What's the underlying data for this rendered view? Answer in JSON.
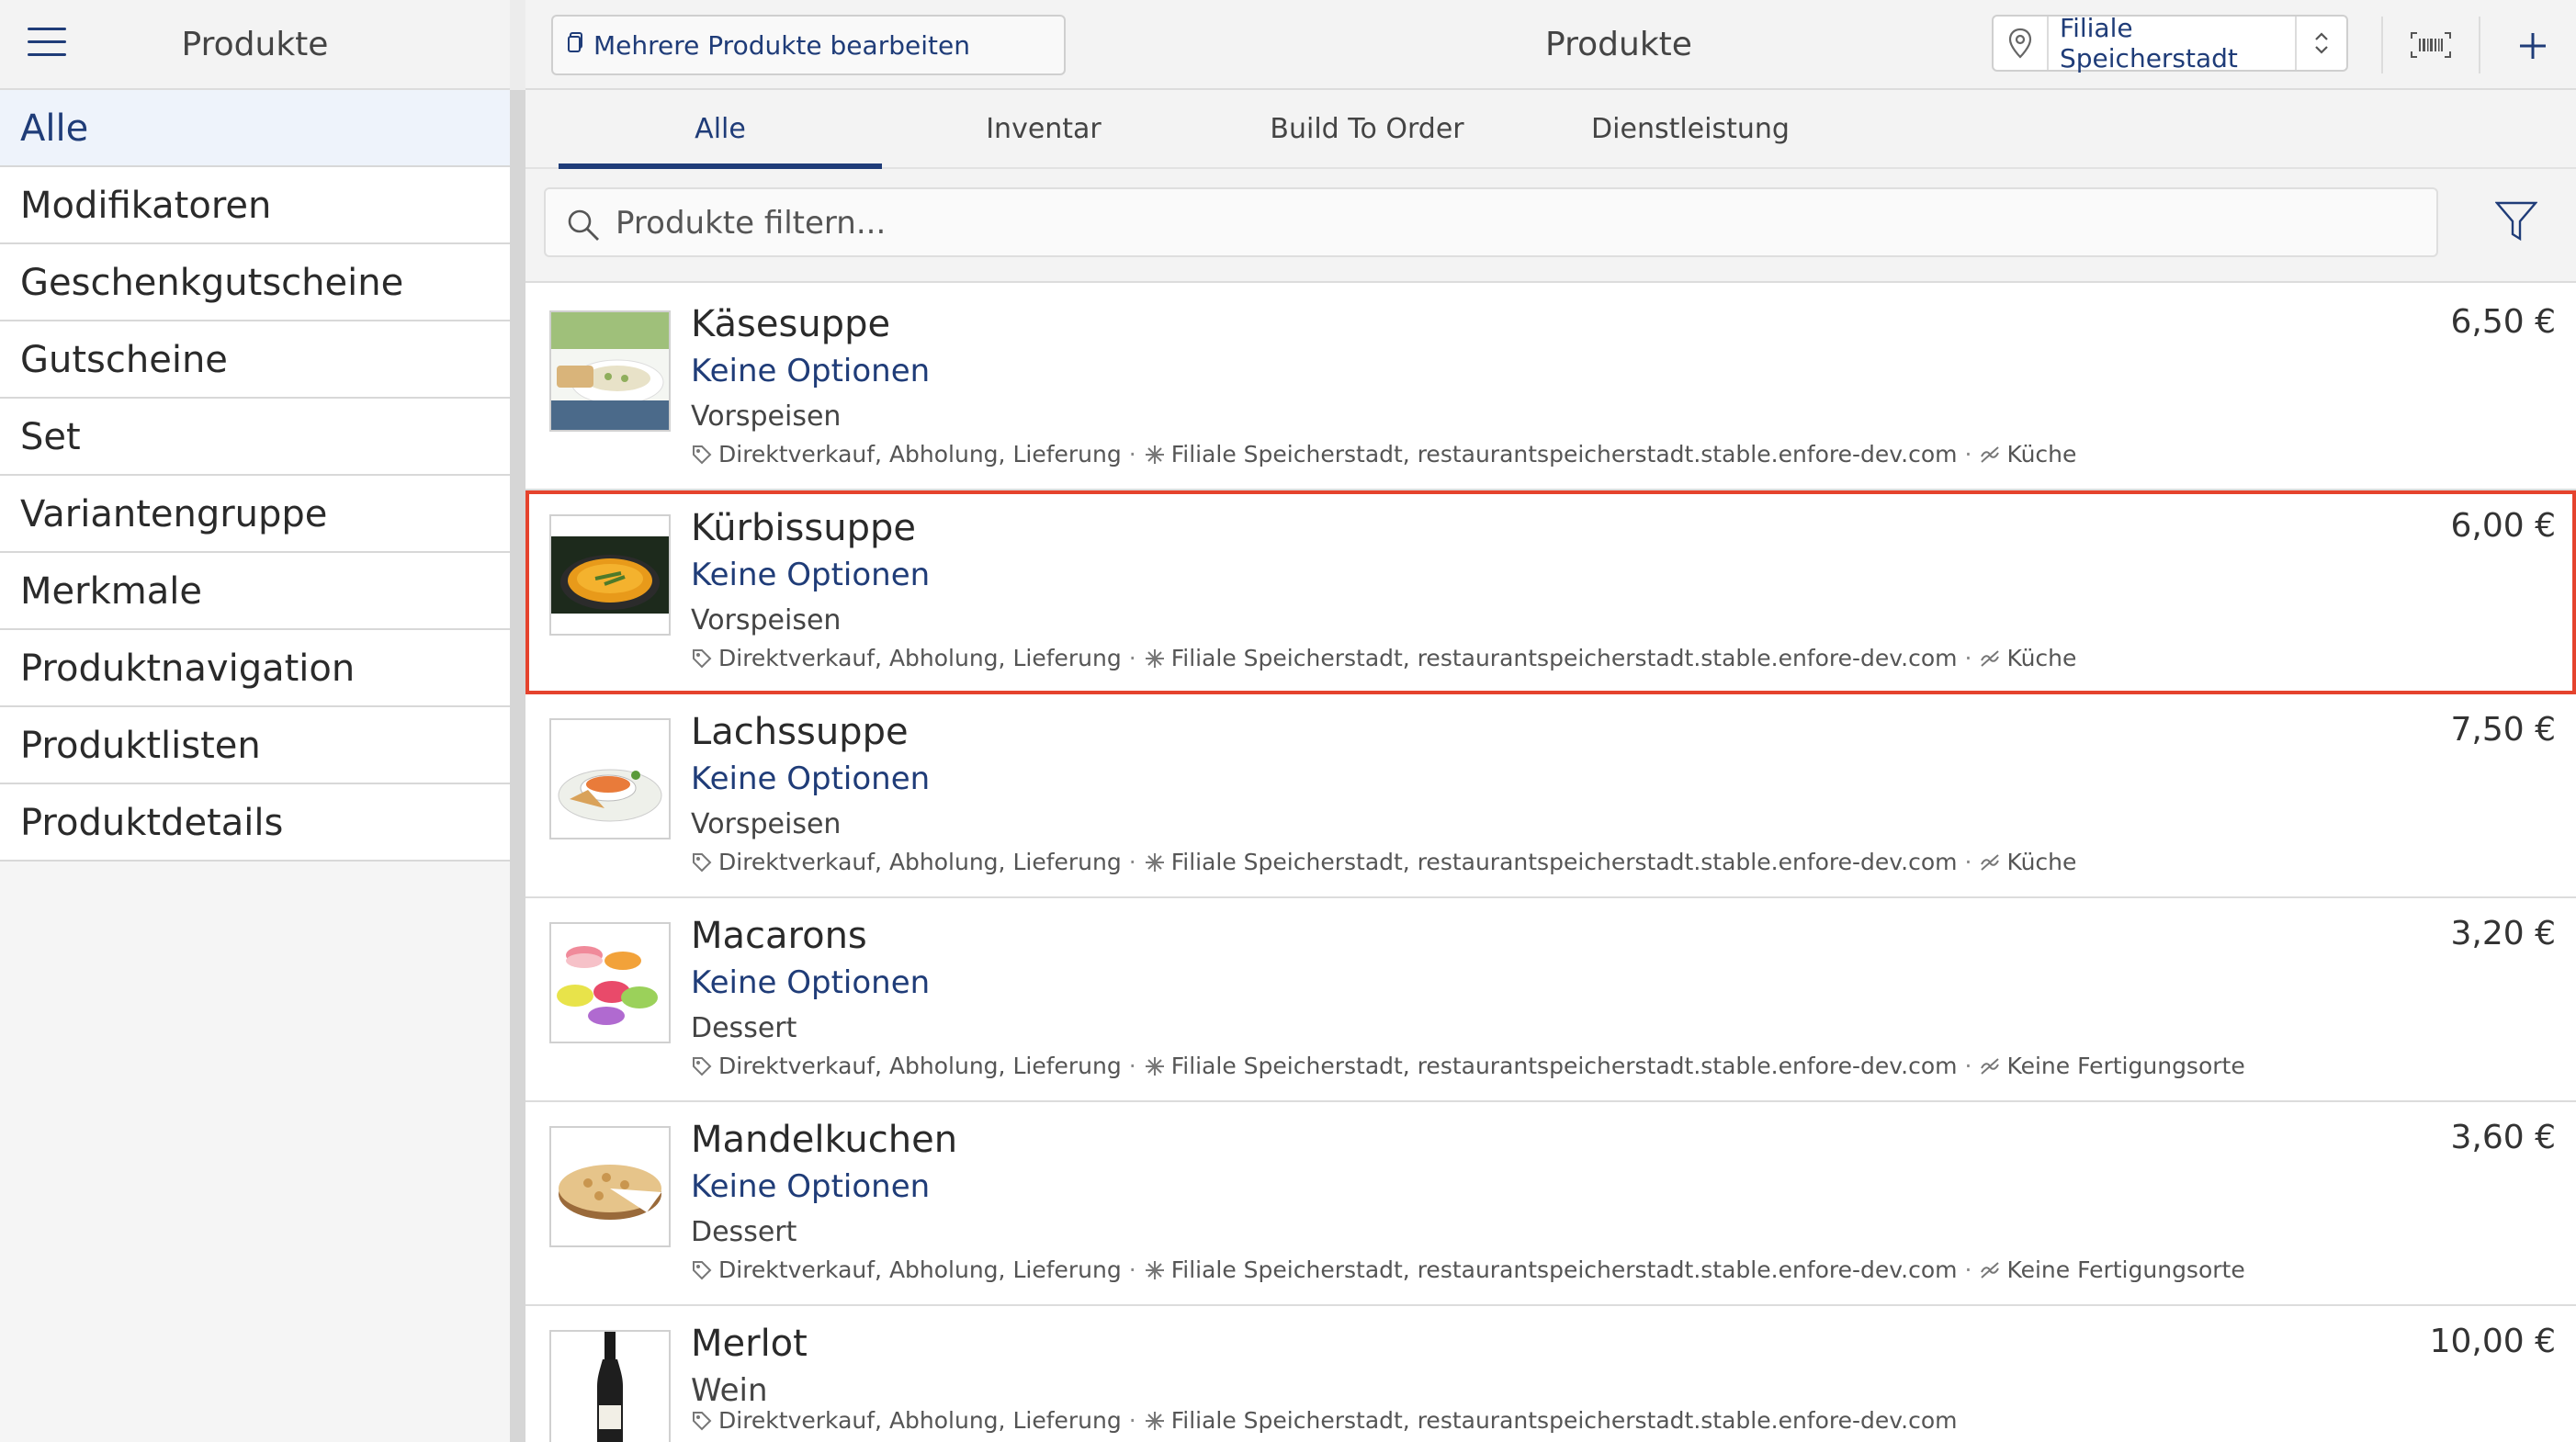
{
  "sidebar": {
    "title": "Produkte",
    "items": [
      {
        "label": "Alle"
      },
      {
        "label": "Modifikatoren"
      },
      {
        "label": "Geschenkgutscheine"
      },
      {
        "label": "Gutscheine"
      },
      {
        "label": "Set"
      },
      {
        "label": "Variantengruppe"
      },
      {
        "label": "Merkmale"
      },
      {
        "label": "Produktnavigation"
      },
      {
        "label": "Produktlisten"
      },
      {
        "label": "Produktdetails"
      }
    ]
  },
  "header": {
    "multi_edit_label": "Mehrere Produkte bearbeiten",
    "title": "Produkte",
    "branch": "Filiale Speicherstadt"
  },
  "tabs": [
    {
      "label": "Alle"
    },
    {
      "label": "Inventar"
    },
    {
      "label": "Build To Order"
    },
    {
      "label": "Dienstleistung"
    }
  ],
  "search": {
    "placeholder": "Produkte filtern..."
  },
  "products": [
    {
      "name": "Käsesuppe",
      "options": "Keine Optionen",
      "category": "Vorspeisen",
      "channels": "Direktverkauf, Abholung, Lieferung",
      "locations": "Filiale Speicherstadt, restaurantspeicherstadt.stable.enfore-dev.com",
      "production": "Küche",
      "price": "6,50 €"
    },
    {
      "name": "Kürbissuppe",
      "options": "Keine Optionen",
      "category": "Vorspeisen",
      "channels": "Direktverkauf, Abholung, Lieferung",
      "locations": "Filiale Speicherstadt, restaurantspeicherstadt.stable.enfore-dev.com",
      "production": "Küche",
      "price": "6,00 €"
    },
    {
      "name": "Lachssuppe",
      "options": "Keine Optionen",
      "category": "Vorspeisen",
      "channels": "Direktverkauf, Abholung, Lieferung",
      "locations": "Filiale Speicherstadt, restaurantspeicherstadt.stable.enfore-dev.com",
      "production": "Küche",
      "price": "7,50 €"
    },
    {
      "name": "Macarons",
      "options": "Keine Optionen",
      "category": "Dessert",
      "channels": "Direktverkauf, Abholung, Lieferung",
      "locations": "Filiale Speicherstadt, restaurantspeicherstadt.stable.enfore-dev.com",
      "production": "Keine Fertigungsorte",
      "price": "3,20 €"
    },
    {
      "name": "Mandelkuchen",
      "options": "Keine Optionen",
      "category": "Dessert",
      "channels": "Direktverkauf, Abholung, Lieferung",
      "locations": "Filiale Speicherstadt, restaurantspeicherstadt.stable.enfore-dev.com",
      "production": "Keine Fertigungsorte",
      "price": "3,60 €"
    },
    {
      "name": "Merlot",
      "options": "Wein",
      "category": "",
      "channels": "Direktverkauf, Abholung, Lieferung",
      "locations": "Filiale Speicherstadt, restaurantspeicherstadt.stable.enfore-dev.com",
      "production": "",
      "price": "10,00 €"
    }
  ],
  "colors": {
    "accent": "#1f3c78",
    "selection": "#e5432d"
  }
}
